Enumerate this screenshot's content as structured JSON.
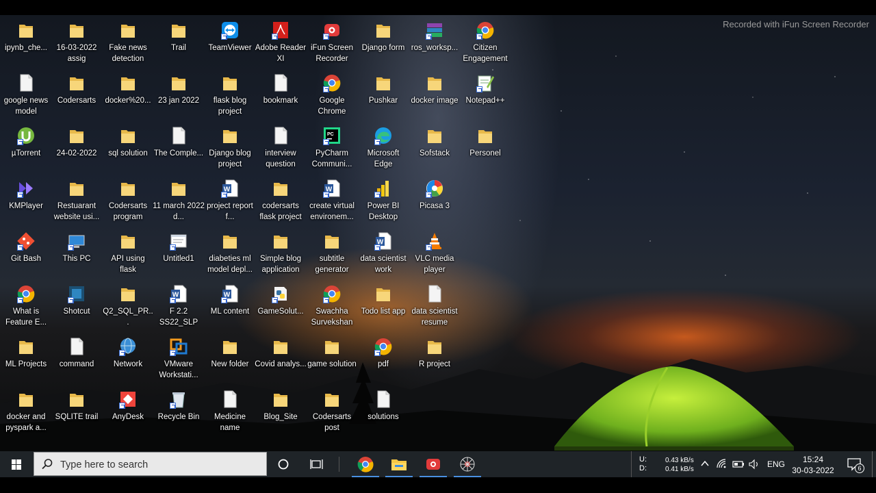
{
  "watermark": "Recorded with iFun Screen Recorder",
  "desktop_icons": [
    {
      "label": "ipynb_che...",
      "icon": "folder-icon"
    },
    {
      "label": "google news model",
      "icon": "document-icon"
    },
    {
      "label": "µTorrent",
      "icon": "utorrent-icon"
    },
    {
      "label": "KMPlayer",
      "icon": "kmplayer-icon"
    },
    {
      "label": "Git Bash",
      "icon": "git-icon"
    },
    {
      "label": "What is Feature E...",
      "icon": "chrome-icon"
    },
    {
      "label": "ML Projects",
      "icon": "folder-icon"
    },
    {
      "label": "docker and pyspark a...",
      "icon": "folder-icon"
    },
    {
      "label": "16-03-2022 assig",
      "icon": "folder-icon"
    },
    {
      "label": "Codersarts",
      "icon": "folder-icon"
    },
    {
      "label": "24-02-2022",
      "icon": "folder-icon"
    },
    {
      "label": "Restuarant website usi...",
      "icon": "folder-icon"
    },
    {
      "label": "This PC",
      "icon": "computer-icon"
    },
    {
      "label": "Shotcut",
      "icon": "shotcut-icon"
    },
    {
      "label": "command",
      "icon": "document-icon"
    },
    {
      "label": "SQLITE trail",
      "icon": "folder-icon"
    },
    {
      "label": "Fake news detection",
      "icon": "folder-icon"
    },
    {
      "label": "docker%20...",
      "icon": "folder-icon"
    },
    {
      "label": "sql solution",
      "icon": "folder-icon"
    },
    {
      "label": "Codersarts program",
      "icon": "folder-icon"
    },
    {
      "label": "API using flask",
      "icon": "folder-icon"
    },
    {
      "label": "Q2_SQL_PR...",
      "icon": "folder-icon"
    },
    {
      "label": "Network",
      "icon": "network-icon"
    },
    {
      "label": "AnyDesk",
      "icon": "anydesk-icon"
    },
    {
      "label": "Trail",
      "icon": "folder-icon"
    },
    {
      "label": "23 jan 2022",
      "icon": "folder-icon"
    },
    {
      "label": "The Comple...",
      "icon": "document-icon"
    },
    {
      "label": "11 march 2022 d...",
      "icon": "folder-icon"
    },
    {
      "label": "Untitled1",
      "icon": "text-file-icon"
    },
    {
      "label": "F 2.2 SS22_SLP E...",
      "icon": "word-icon"
    },
    {
      "label": "VMware Workstati...",
      "icon": "vmware-icon"
    },
    {
      "label": "Recycle Bin",
      "icon": "recycle-bin-icon"
    },
    {
      "label": "TeamViewer",
      "icon": "teamviewer-icon"
    },
    {
      "label": "flask blog project",
      "icon": "folder-icon"
    },
    {
      "label": "Django blog project",
      "icon": "folder-icon"
    },
    {
      "label": "project report f...",
      "icon": "word-icon"
    },
    {
      "label": "diabeties ml model depl...",
      "icon": "folder-icon"
    },
    {
      "label": "ML content",
      "icon": "word-icon"
    },
    {
      "label": "New folder",
      "icon": "folder-icon"
    },
    {
      "label": "Medicine name",
      "icon": "document-icon"
    },
    {
      "label": "Adobe Reader XI",
      "icon": "adobe-icon"
    },
    {
      "label": "bookmark",
      "icon": "document-icon"
    },
    {
      "label": "interview question",
      "icon": "document-icon"
    },
    {
      "label": "codersarts flask project",
      "icon": "folder-icon"
    },
    {
      "label": "Simple blog application",
      "icon": "folder-icon"
    },
    {
      "label": "GameSolut...",
      "icon": "python-icon"
    },
    {
      "label": "Covid analys...",
      "icon": "folder-icon"
    },
    {
      "label": "Blog_Site",
      "icon": "folder-icon"
    },
    {
      "label": "iFun Screen Recorder",
      "icon": "recorder-icon"
    },
    {
      "label": "Google Chrome",
      "icon": "chrome-icon"
    },
    {
      "label": "PyCharm Communi...",
      "icon": "pycharm-icon"
    },
    {
      "label": "create virtual environem...",
      "icon": "word-icon"
    },
    {
      "label": "subtitle generator",
      "icon": "folder-icon"
    },
    {
      "label": "Swachha Survekshan",
      "icon": "chrome-icon"
    },
    {
      "label": "game solution",
      "icon": "folder-icon"
    },
    {
      "label": "Codersarts post",
      "icon": "folder-icon"
    },
    {
      "label": "Django form",
      "icon": "folder-icon"
    },
    {
      "label": "Pushkar",
      "icon": "folder-icon"
    },
    {
      "label": "Microsoft Edge",
      "icon": "edge-icon"
    },
    {
      "label": "Power BI Desktop",
      "icon": "powerbi-icon"
    },
    {
      "label": "data scientist work",
      "icon": "word-icon"
    },
    {
      "label": "Todo list app",
      "icon": "folder-icon"
    },
    {
      "label": "pdf",
      "icon": "chrome-icon"
    },
    {
      "label": "solutions",
      "icon": "document-icon"
    },
    {
      "label": "ros_worksp...",
      "icon": "winrar-icon"
    },
    {
      "label": "docker image",
      "icon": "folder-icon"
    },
    {
      "label": "Sofstack",
      "icon": "folder-icon"
    },
    {
      "label": "Picasa 3",
      "icon": "picasa-icon"
    },
    {
      "label": "VLC media player",
      "icon": "vlc-icon"
    },
    {
      "label": "data scientist resume",
      "icon": "document-icon"
    },
    {
      "label": "R project",
      "icon": "folder-icon"
    },
    {
      "label": "Citizen Engagement",
      "icon": "chrome-icon"
    },
    {
      "label": "Notepad++",
      "icon": "notepadpp-icon"
    },
    {
      "label": "Personel",
      "icon": "folder-icon"
    }
  ],
  "taskbar": {
    "search_placeholder": "Type here to search",
    "apps": [
      "chrome-icon",
      "file-explorer-icon",
      "recorder-icon",
      "spider-icon"
    ],
    "network_upload_label": "U:",
    "network_download_label": "D:",
    "upload_speed": "0.43 kB/s",
    "download_speed": "0.41 kB/s",
    "language": "ENG",
    "time": "15:24",
    "date": "30-03-2022",
    "notification_count": "6"
  }
}
